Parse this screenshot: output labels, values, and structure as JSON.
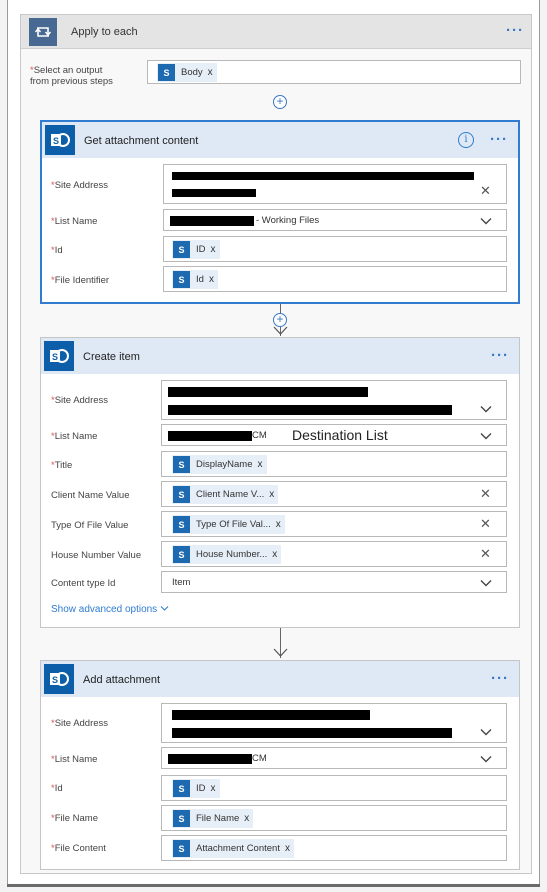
{
  "apply": {
    "title": "Apply to each",
    "select_label": "Select an output",
    "select_label2": "from previous steps",
    "select_token": "Body",
    "more": "···"
  },
  "get_attachment": {
    "title": "Get attachment content",
    "more": "···",
    "info": "i",
    "fields": {
      "site_address": "Site Address",
      "list_name": "List Name",
      "list_value_suffix": "- Working Files",
      "id": "Id",
      "id_token": "ID",
      "file_identifier": "File Identifier",
      "file_identifier_token": "Id"
    }
  },
  "create_item": {
    "title": "Create item",
    "more": "···",
    "fields": {
      "site_address": "Site Address",
      "list_name": "List Name",
      "list_value_suffix": "CM",
      "destination_note": "Destination List",
      "title": "Title",
      "title_token": "DisplayName",
      "client_name": "Client Name Value",
      "client_name_token": "Client Name V...",
      "type_of_file": "Type Of File Value",
      "type_of_file_token": "Type Of File Val...",
      "house_number": "House Number Value",
      "house_number_token": "House Number...",
      "content_type": "Content type Id",
      "content_type_value": "Item"
    },
    "show_advanced": "Show advanced options"
  },
  "add_attachment": {
    "title": "Add attachment",
    "more": "···",
    "fields": {
      "site_address": "Site Address",
      "list_name": "List Name",
      "list_value_suffix": "CM",
      "id": "Id",
      "id_token": "ID",
      "file_name": "File Name",
      "file_name_token": "File Name",
      "file_content": "File Content",
      "file_content_token": "Attachment Content"
    }
  },
  "common": {
    "required_mark": "*",
    "token_remove": "x",
    "sp_glyph": "S",
    "add": "+",
    "clear": "✕"
  },
  "colors": {
    "accent": "#2f7cd1",
    "sharepoint": "#0d5ea8",
    "loop": "#486991",
    "header_bg": "#dfe9f5"
  }
}
